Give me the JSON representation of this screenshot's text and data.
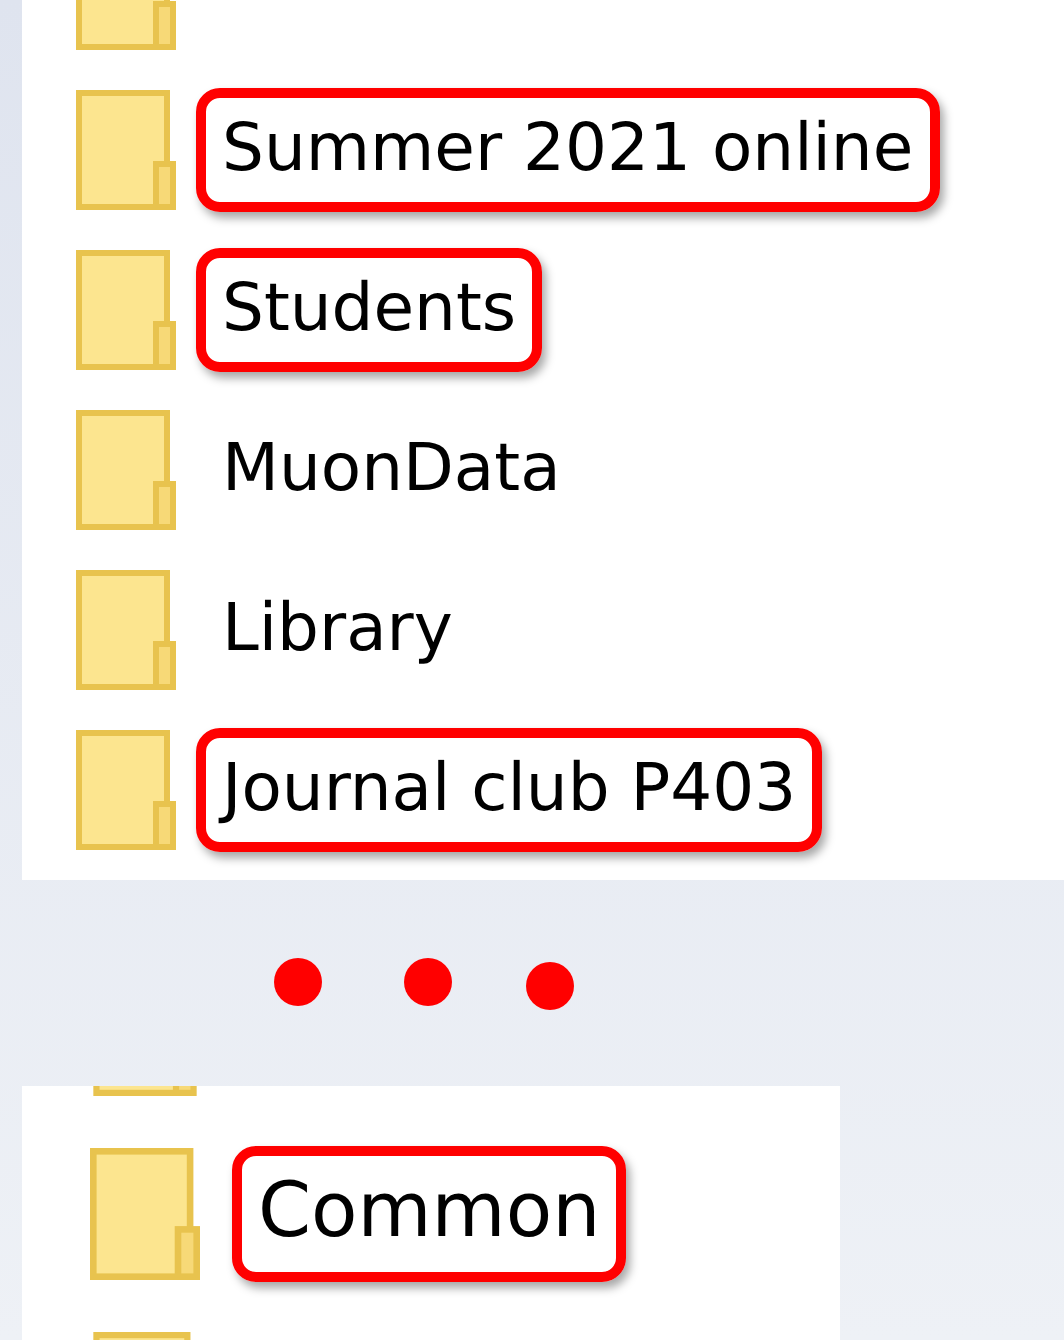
{
  "top_list": {
    "items": [
      {
        "name": "Summer 2021 online",
        "highlighted": true
      },
      {
        "name": "Students",
        "highlighted": true
      },
      {
        "name": "MuonData",
        "highlighted": false
      },
      {
        "name": "Library",
        "highlighted": false
      },
      {
        "name": "Journal club P403",
        "highlighted": true
      }
    ]
  },
  "bottom_list": {
    "items": [
      {
        "name": "Common",
        "highlighted": true
      }
    ]
  }
}
